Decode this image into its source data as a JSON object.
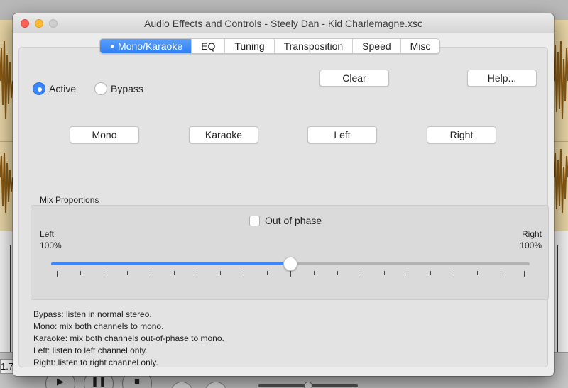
{
  "background_app": {
    "zoom_readout": "1.7"
  },
  "window": {
    "title": "Audio Effects and Controls - Steely Dan - Kid Charlemagne.xsc"
  },
  "tabs": [
    {
      "label": "Mono/Karaoke",
      "active": true
    },
    {
      "label": "EQ",
      "active": false
    },
    {
      "label": "Tuning",
      "active": false
    },
    {
      "label": "Transposition",
      "active": false
    },
    {
      "label": "Speed",
      "active": false
    },
    {
      "label": "Misc",
      "active": false
    }
  ],
  "mode": {
    "active_label": "Active",
    "bypass_label": "Bypass",
    "selected": "active"
  },
  "buttons": {
    "clear": "Clear",
    "help": "Help...",
    "mono": "Mono",
    "karaoke": "Karaoke",
    "left": "Left",
    "right": "Right"
  },
  "mix": {
    "section_label": "Mix Proportions",
    "out_of_phase_label": "Out of phase",
    "out_of_phase_checked": false,
    "left_label": "Left",
    "left_value": "100%",
    "right_label": "Right",
    "right_value": "100%",
    "slider_fraction": 0.5,
    "tick_count": 21
  },
  "help_lines": [
    "Bypass: listen in normal stereo.",
    "Mono: mix both channels to mono.",
    "Karaoke: mix both channels out-of-phase to mono.",
    "Left: listen to left channel only.",
    "Right: listen to right channel only."
  ],
  "colors": {
    "accent": "#3d86f6",
    "close": "#fd5f57",
    "minimize": "#febb2e",
    "waveform": "#8a5a14",
    "waveform_bg": "#e9d6a6"
  }
}
